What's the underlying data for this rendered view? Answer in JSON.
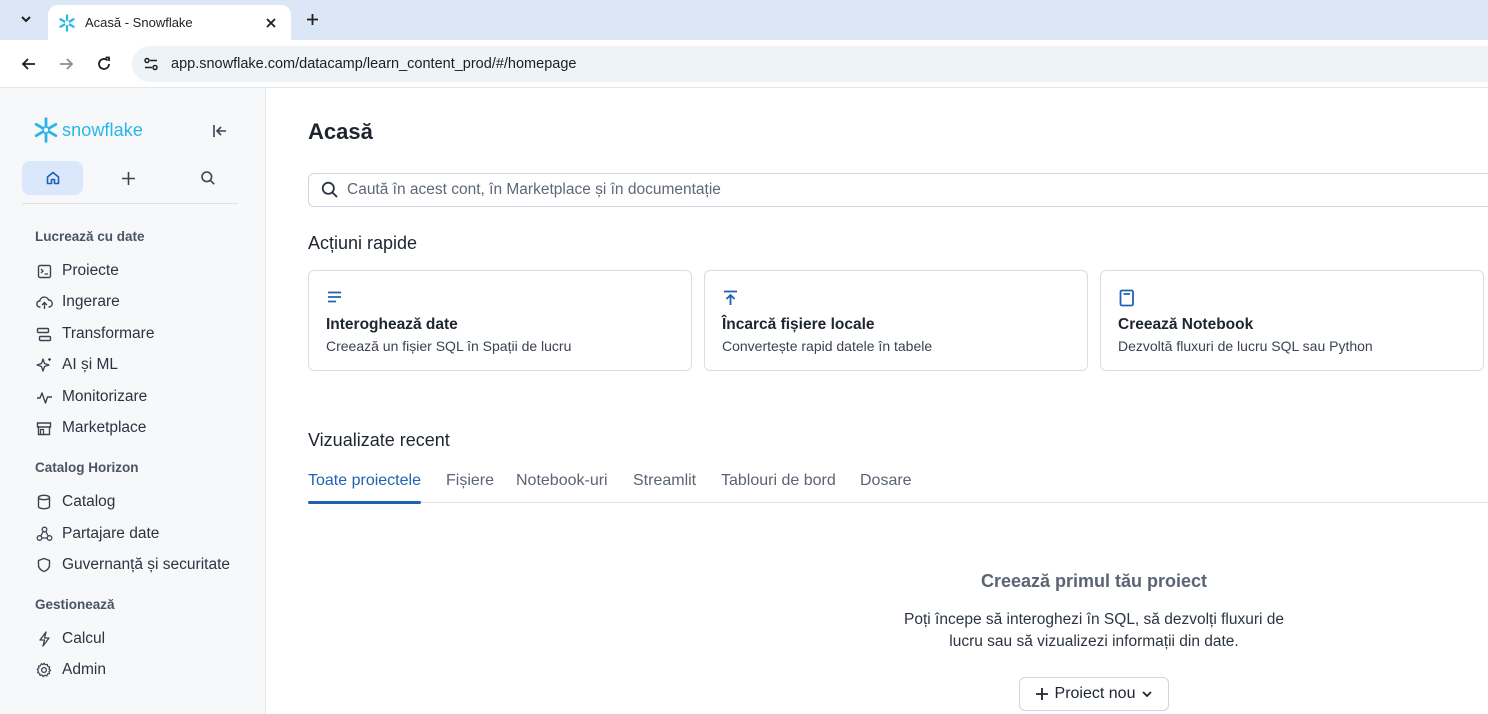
{
  "browser": {
    "tab_title": "Acasă - Snowflake",
    "url": "app.snowflake.com/datacamp/learn_content_prod/#/homepage"
  },
  "sidebar": {
    "logo_text": "snowflake",
    "sections": [
      {
        "label": "Lucrează cu date",
        "items": [
          {
            "label": "Proiecte",
            "icon": "projects-icon"
          },
          {
            "label": "Ingerare",
            "icon": "cloud-upload-icon"
          },
          {
            "label": "Transformare",
            "icon": "transform-icon"
          },
          {
            "label": "AI și ML",
            "icon": "sparkle-icon"
          },
          {
            "label": "Monitorizare",
            "icon": "activity-icon"
          },
          {
            "label": "Marketplace",
            "icon": "store-icon"
          }
        ]
      },
      {
        "label": "Catalog Horizon",
        "items": [
          {
            "label": "Catalog",
            "icon": "database-icon"
          },
          {
            "label": "Partajare date",
            "icon": "share-icon"
          },
          {
            "label": "Guvernanță și securitate",
            "icon": "shield-icon"
          }
        ]
      },
      {
        "label": "Gestionează",
        "items": [
          {
            "label": "Calcul",
            "icon": "lightning-icon"
          },
          {
            "label": "Admin",
            "icon": "gear-icon"
          }
        ]
      }
    ]
  },
  "main": {
    "title": "Acasă",
    "search_placeholder": "Caută în acest cont, în Marketplace și în documentație",
    "quick_actions_title": "Acțiuni rapide",
    "quick_actions": [
      {
        "title": "Interoghează date",
        "desc": "Creează un fișier SQL în Spații de lucru",
        "icon": "lines-icon"
      },
      {
        "title": "Încarcă fișiere locale",
        "desc": "Convertește rapid datele în tabele",
        "icon": "upload-icon"
      },
      {
        "title": "Creează Notebook",
        "desc": "Dezvoltă fluxuri de lucru SQL sau Python",
        "icon": "notebook-icon"
      }
    ],
    "recent_title": "Vizualizate recent",
    "tabs": [
      "Toate proiectele",
      "Fișiere",
      "Notebook-uri",
      "Streamlit",
      "Tablouri de bord",
      "Dosare"
    ],
    "active_tab": "Toate proiectele",
    "empty_title": "Creează primul tău proiect",
    "empty_desc": "Poți începe să interoghezi în SQL, să dezvolți fluxuri de lucru sau să vizualizezi informații din date.",
    "new_project_label": "Proiect nou"
  },
  "colors": {
    "brand": "#29b5e8",
    "accent": "#1f62b4",
    "active_quick_bg": "#dbe8fb"
  }
}
